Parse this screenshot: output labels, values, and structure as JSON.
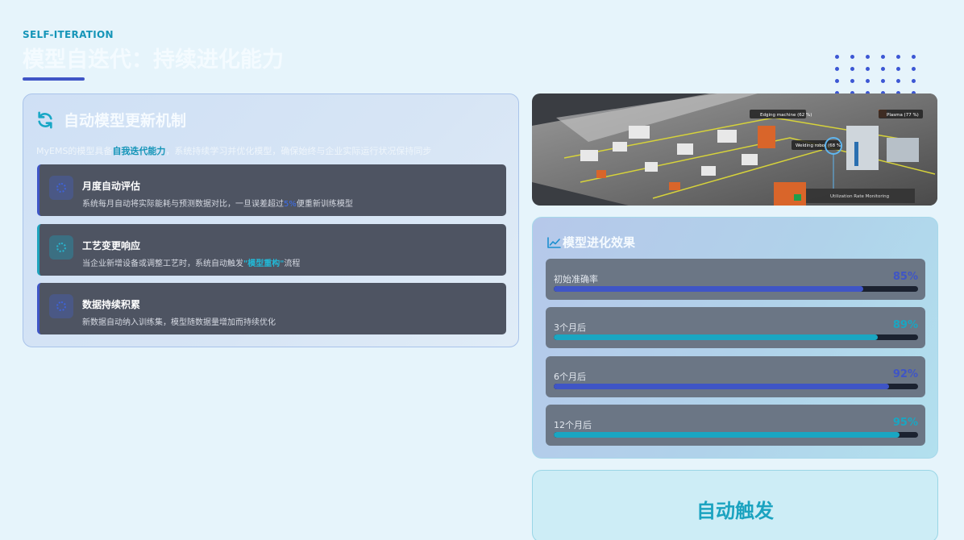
{
  "header": {
    "eyebrow": "SELF-ITERATION",
    "title": "模型自迭代：持续进化能力"
  },
  "left_card": {
    "title": "自动模型更新机制",
    "icon": "refresh-icon",
    "intro_prefix": "MyEMS的模型具备",
    "intro_highlight": "自我迭代能力",
    "intro_suffix": "，系统持续学习并优化模型，确保始终与企业实际运行状况保持同步",
    "items": [
      {
        "title": "月度自动评估",
        "desc_prefix": "系统每月自动将实际能耗与预测数据对比，一旦误差超过",
        "desc_key": "5%",
        "desc_suffix": "便重新训练模型",
        "icon": "gear-icon"
      },
      {
        "title": "工艺变更响应",
        "desc_prefix": "当企业新增设备或调整工艺时，系统自动触发",
        "desc_key": "\"模型重构\"",
        "desc_suffix": "流程",
        "icon": "cogs-icon"
      },
      {
        "title": "数据持续积累",
        "desc": "新数据自动纳入训练集，模型随数据量增加而持续优化",
        "icon": "database-icon"
      }
    ]
  },
  "photo": {
    "labels": [
      "Edging machine (62 %)",
      "Plasma (77 %)",
      "Welding robot (68 %)",
      "Utilization Rate Monitoring"
    ]
  },
  "evolution": {
    "title": "模型进化效果",
    "icon": "chart-line-icon",
    "rows": [
      {
        "label": "初始准确率",
        "pct_text": "85%",
        "value": 85,
        "color": "#3f55c6"
      },
      {
        "label": "3个月后",
        "pct_text": "89%",
        "value": 89,
        "color": "#1aa6c2"
      },
      {
        "label": "6个月后",
        "pct_text": "92%",
        "value": 92,
        "color": "#3f55c6"
      },
      {
        "label": "12个月后",
        "pct_text": "95%",
        "value": 95,
        "color": "#1aa6c2"
      }
    ]
  },
  "trigger": {
    "label": "自动触发"
  }
}
